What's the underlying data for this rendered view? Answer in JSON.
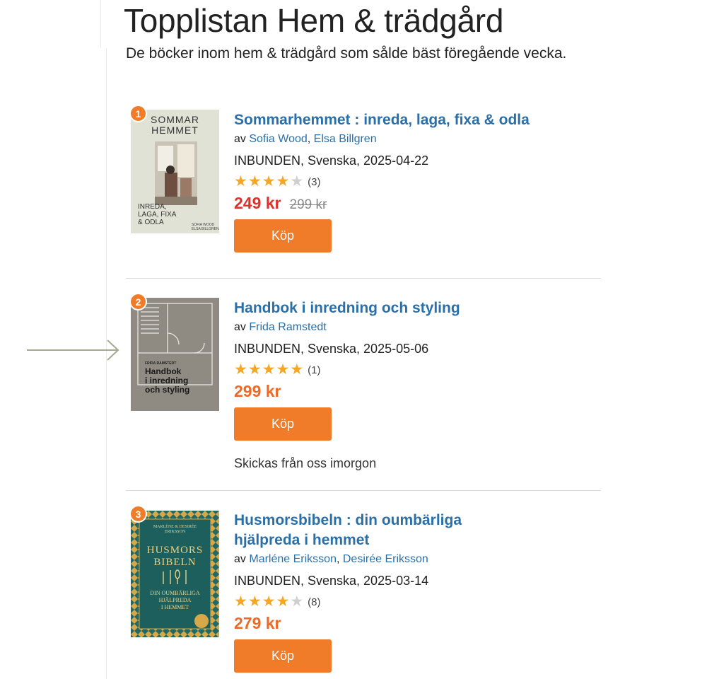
{
  "header": {
    "title": "Topplistan Hem & trädgård",
    "subtitle": "De böcker inom hem & trädgård som sålde bäst föregående vecka."
  },
  "books": [
    {
      "rank": "1",
      "title": "Sommarhemmet : inreda, laga, fixa & odla",
      "by": "av",
      "authors": [
        "Sofia Wood",
        "Elsa Billgren"
      ],
      "meta": "INBUNDEN, Svenska, 2025-04-22",
      "rating": 4,
      "rating_count": "(3)",
      "price": "249 kr",
      "old_price": "299 kr",
      "buy_label": "Köp",
      "cover": {
        "top_text": "SOMMAR\nHEMMET",
        "bottom_text": "INREDA,\nLAGA, FIXA\n& ODLA",
        "authors_text": "SOFIA WOOD\nELSA BILLGREN"
      }
    },
    {
      "rank": "2",
      "title": "Handbok i inredning och styling",
      "by": "av",
      "authors": [
        "Frida Ramstedt"
      ],
      "meta": "INBUNDEN, Svenska, 2025-05-06",
      "rating": 5,
      "rating_count": "(1)",
      "price": "299 kr",
      "buy_label": "Köp",
      "delivery": "Skickas från oss imorgon",
      "cover": {
        "author_text": "FRIDA RAMSTEDT",
        "title_text": "Handbok\ni inredning\noch styling"
      }
    },
    {
      "rank": "3",
      "title": "Husmorsbibeln : din oumbärliga hjälpreda i hemmet",
      "by": "av",
      "authors": [
        "Marléne Eriksson",
        "Desirée Eriksson"
      ],
      "meta": "INBUNDEN, Svenska, 2025-03-14",
      "rating": 4,
      "rating_count": "(8)",
      "price": "279 kr",
      "buy_label": "Köp",
      "cover": {
        "author_text": "MARLÉNE & DESIRÉE\nERIKSSON",
        "title_text": "HUSMORS\nBIBELN",
        "subtitle_text": "DIN OUMBÄRLIGA\nHJÄLPREDA\nI HEMMET"
      }
    }
  ],
  "colors": {
    "link": "#2a6fa8",
    "buy_button": "#f07c2a",
    "sale_price": "#e0302c",
    "price": "#ec6a25",
    "star": "#f5a623"
  }
}
